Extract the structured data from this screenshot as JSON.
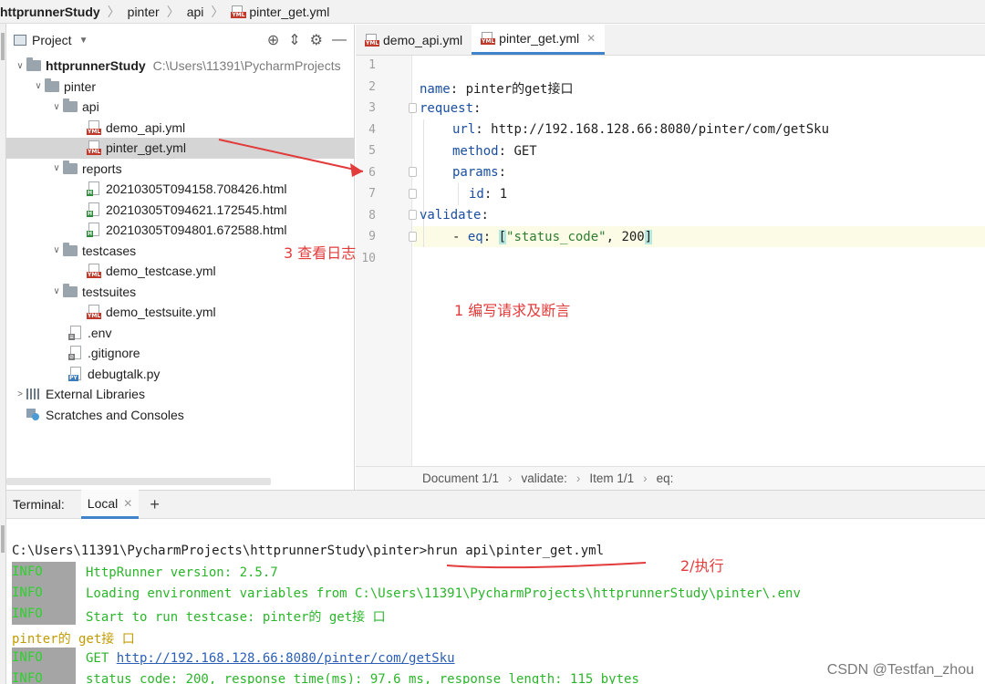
{
  "breadcrumb": {
    "items": [
      "httprunnerStudy",
      "pinter",
      "api",
      "pinter_get.yml"
    ]
  },
  "project_panel": {
    "title": "Project",
    "tree": [
      {
        "label": "httprunnerStudy",
        "hint": "C:\\Users\\11391\\PycharmProjects",
        "type": "root-folder"
      },
      {
        "label": "pinter",
        "type": "folder"
      },
      {
        "label": "api",
        "type": "folder"
      },
      {
        "label": "demo_api.yml",
        "type": "yml"
      },
      {
        "label": "pinter_get.yml",
        "type": "yml",
        "selected": true
      },
      {
        "label": "reports",
        "type": "folder"
      },
      {
        "label": "20210305T094158.708426.html",
        "type": "html"
      },
      {
        "label": "20210305T094621.172545.html",
        "type": "html"
      },
      {
        "label": "20210305T094801.672588.html",
        "type": "html"
      },
      {
        "label": "testcases",
        "type": "folder"
      },
      {
        "label": "demo_testcase.yml",
        "type": "yml"
      },
      {
        "label": "testsuites",
        "type": "folder"
      },
      {
        "label": "demo_testsuite.yml",
        "type": "yml"
      },
      {
        "label": ".env",
        "type": "env"
      },
      {
        "label": ".gitignore",
        "type": "git"
      },
      {
        "label": "debugtalk.py",
        "type": "py"
      },
      {
        "label": "External Libraries",
        "type": "lib"
      },
      {
        "label": "Scratches and Consoles",
        "type": "scratch"
      }
    ]
  },
  "editor": {
    "tabs": [
      {
        "label": "demo_api.yml",
        "active": false
      },
      {
        "label": "pinter_get.yml",
        "active": true
      }
    ],
    "line_numbers": [
      "1",
      "2",
      "3",
      "4",
      "5",
      "6",
      "7",
      "8",
      "9",
      "10"
    ],
    "code": {
      "l2_key": "name",
      "l2_val": " pinter的get接口",
      "l3_key": "request",
      "l4_key": "url",
      "l4_val": " http://192.168.128.66:8080/pinter/com/getSku",
      "l5_key": "method",
      "l5_val": " GET",
      "l6_key": "params",
      "l7_key": "id",
      "l7_val": " 1",
      "l8_key": "validate",
      "l9_dash": "- ",
      "l9_key": "eq",
      "l9_open": "[",
      "l9_str": "\"status_code\"",
      "l9_rest": ", 200",
      "l9_close": "]"
    },
    "status_bar": [
      "Document 1/1",
      "validate:",
      "Item 1/1",
      "eq:"
    ]
  },
  "terminal": {
    "label": "Terminal:",
    "tab": "Local",
    "command": "C:\\Users\\11391\\PycharmProjects\\httprunnerStudy\\pinter>hrun api\\pinter_get.yml",
    "lines": [
      {
        "level": "INFO",
        "msg": "HttpRunner version: 2.5.7"
      },
      {
        "level": "INFO",
        "msg": "Loading environment variables from C:\\Users\\11391\\PycharmProjects\\httprunnerStudy\\pinter\\.env"
      },
      {
        "level": "INFO",
        "msg": "Start to run testcase: pinter的 get接 口"
      }
    ],
    "testcase_title": "pinter的 get接 口",
    "get_prefix": "GET ",
    "get_url": "http://192.168.128.66:8080/pinter/com/getSku",
    "last_line": {
      "level": "INFO",
      "msg": "status_code: 200, response_time(ms): 97.6 ms, response_length: 115 bytes"
    }
  },
  "annotations": {
    "a1": "1 编写请求及断言",
    "a2": "2/执行",
    "a3": "3 查看日志"
  },
  "watermark": "CSDN @Testfan_zhou",
  "colors": {
    "annotation": "#e23b3b",
    "yaml_key": "#1a4fa0",
    "yaml_string": "#2e7d32",
    "log_green": "#2bb52b",
    "accent": "#4083c9"
  }
}
